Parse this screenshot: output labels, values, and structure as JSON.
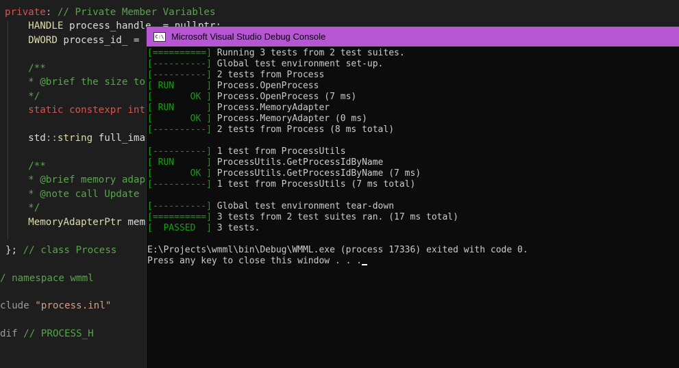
{
  "editor": {
    "lines": [
      {
        "parts": [
          {
            "t": "private",
            "c": "kw"
          },
          {
            "t": ":",
            "c": "punct"
          },
          {
            "t": " // Private Member Variables",
            "c": "comment"
          }
        ]
      },
      {
        "parts": [
          {
            "t": "    HANDLE",
            "c": "type"
          },
          {
            "t": " process_handle_ = nullptr;",
            "c": "ident"
          }
        ]
      },
      {
        "parts": [
          {
            "t": "    DWORD",
            "c": "type"
          },
          {
            "t": " process_id_ = ",
            "c": "ident"
          }
        ]
      },
      {
        "parts": []
      },
      {
        "parts": [
          {
            "t": "    /**",
            "c": "comment"
          }
        ]
      },
      {
        "parts": [
          {
            "t": "    * @brief the size to",
            "c": "comment"
          }
        ]
      },
      {
        "parts": [
          {
            "t": "    */",
            "c": "comment"
          }
        ]
      },
      {
        "parts": [
          {
            "t": "    static constexpr int",
            "c": "kw"
          }
        ]
      },
      {
        "parts": []
      },
      {
        "parts": [
          {
            "t": "    std",
            "c": "ident"
          },
          {
            "t": "::",
            "c": "punct"
          },
          {
            "t": "string",
            "c": "type"
          },
          {
            "t": " full_ima",
            "c": "ident"
          }
        ]
      },
      {
        "parts": []
      },
      {
        "parts": [
          {
            "t": "    /**",
            "c": "comment"
          }
        ]
      },
      {
        "parts": [
          {
            "t": "    * @brief memory adap",
            "c": "comment"
          }
        ]
      },
      {
        "parts": [
          {
            "t": "    * @note call Update",
            "c": "comment"
          }
        ]
      },
      {
        "parts": [
          {
            "t": "    */",
            "c": "comment"
          }
        ]
      },
      {
        "parts": [
          {
            "t": "    MemoryAdapterPtr",
            "c": "type"
          },
          {
            "t": " mem",
            "c": "ident"
          }
        ]
      },
      {
        "parts": []
      },
      {
        "parts": [
          {
            "t": "}; ",
            "c": "ident"
          },
          {
            "t": "// class Process",
            "c": "comment"
          }
        ]
      },
      {
        "parts": []
      },
      {
        "parts": [
          {
            "t": "/ namespace wmml",
            "c": "comment"
          }
        ]
      },
      {
        "parts": []
      },
      {
        "parts": [
          {
            "t": "clude ",
            "c": "gray"
          },
          {
            "t": "\"process.inl\"",
            "c": "string"
          }
        ]
      },
      {
        "parts": []
      },
      {
        "parts": [
          {
            "t": "dif ",
            "c": "gray"
          },
          {
            "t": "// PROCESS_H",
            "c": "comment"
          }
        ]
      }
    ]
  },
  "console": {
    "title": "Microsoft Visual Studio Debug Console",
    "icon_text": "C:\\",
    "lines": [
      {
        "tag": "[==========]",
        "msg": " Running 3 tests from 2 test suites."
      },
      {
        "tag": "[----------]",
        "msg": " Global test environment set-up."
      },
      {
        "tag": "[----------]",
        "msg": " 2 tests from Process"
      },
      {
        "tag": "[ RUN      ]",
        "msg": " Process.OpenProcess"
      },
      {
        "tag": "[       OK ]",
        "msg": " Process.OpenProcess (7 ms)"
      },
      {
        "tag": "[ RUN      ]",
        "msg": " Process.MemoryAdapter"
      },
      {
        "tag": "[       OK ]",
        "msg": " Process.MemoryAdapter (0 ms)"
      },
      {
        "tag": "[----------]",
        "msg": " 2 tests from Process (8 ms total)"
      },
      {
        "tag": "",
        "msg": ""
      },
      {
        "tag": "[----------]",
        "msg": " 1 test from ProcessUtils"
      },
      {
        "tag": "[ RUN      ]",
        "msg": " ProcessUtils.GetProcessIdByName"
      },
      {
        "tag": "[       OK ]",
        "msg": " ProcessUtils.GetProcessIdByName (7 ms)"
      },
      {
        "tag": "[----------]",
        "msg": " 1 test from ProcessUtils (7 ms total)"
      },
      {
        "tag": "",
        "msg": ""
      },
      {
        "tag": "[----------]",
        "msg": " Global test environment tear-down"
      },
      {
        "tag": "[==========]",
        "msg": " 3 tests from 2 test suites ran. (17 ms total)"
      },
      {
        "tag": "[  PASSED  ]",
        "msg": " 3 tests."
      },
      {
        "tag": "",
        "msg": ""
      },
      {
        "tag": "",
        "msg": "E:\\Projects\\wmml\\bin\\Debug\\WMML.exe (process 17336) exited with code 0."
      },
      {
        "tag": "",
        "msg": "Press any key to close this window . . ."
      }
    ]
  }
}
